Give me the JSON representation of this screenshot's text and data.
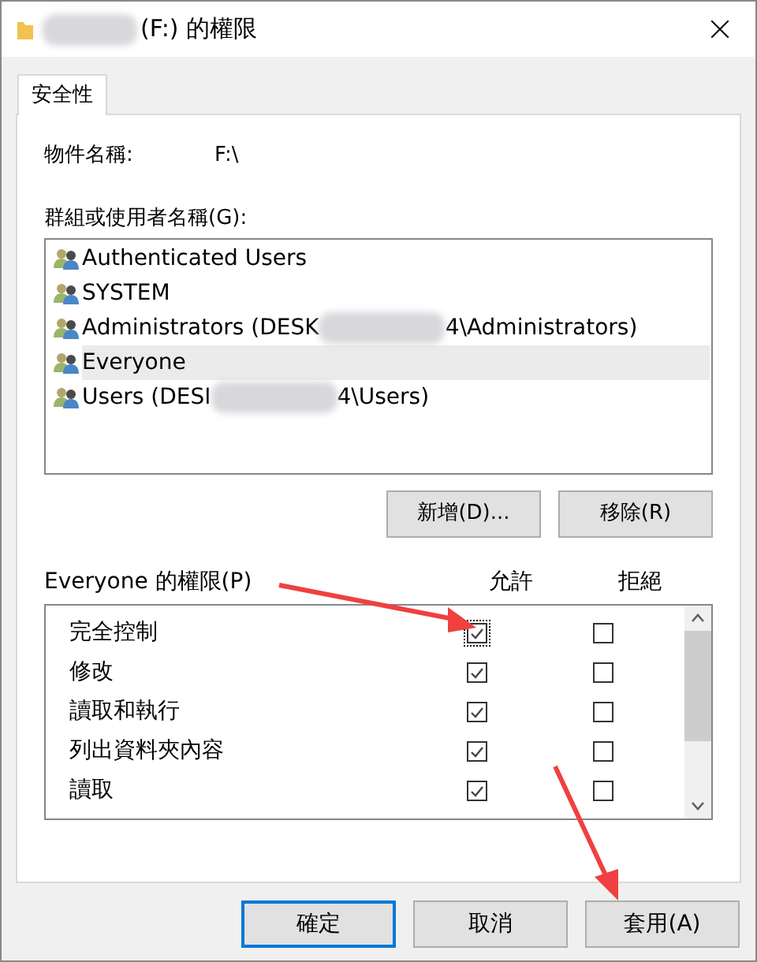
{
  "window": {
    "title": "(F:) 的權限",
    "title_redacted": true
  },
  "tabs": [
    {
      "label": "安全性",
      "selected": true
    }
  ],
  "object_name": {
    "label": "物件名稱:",
    "value": "F:\\"
  },
  "groups": {
    "label": "群組或使用者名稱(G):",
    "items": [
      {
        "text": "Authenticated Users",
        "selected": false
      },
      {
        "text": "SYSTEM",
        "selected": false
      },
      {
        "text": "Administrators (DESK",
        "redacted": true,
        "text_after": "4\\Administrators)",
        "selected": false
      },
      {
        "text": "Everyone",
        "selected": true
      },
      {
        "text": "Users (DESI",
        "redacted": true,
        "text_after": "4\\Users)",
        "selected": false
      }
    ]
  },
  "group_buttons": [
    "新增(D)...",
    "移除(R)"
  ],
  "permissions": {
    "label": "Everyone 的權限(P)",
    "columns": [
      "允許",
      "拒絕"
    ],
    "rows": [
      {
        "name": "完全控制",
        "allow": true,
        "deny": false,
        "focused": true
      },
      {
        "name": "修改",
        "allow": true,
        "deny": false,
        "focused": false
      },
      {
        "name": "讀取和執行",
        "allow": true,
        "deny": false,
        "focused": false
      },
      {
        "name": "列出資料夾內容",
        "allow": true,
        "deny": false,
        "focused": false
      },
      {
        "name": "讀取",
        "allow": true,
        "deny": false,
        "focused": false
      }
    ]
  },
  "buttons": [
    {
      "label": "確定",
      "default": true
    },
    {
      "label": "取消",
      "default": false
    },
    {
      "label": "套用(A)",
      "default": false
    }
  ]
}
